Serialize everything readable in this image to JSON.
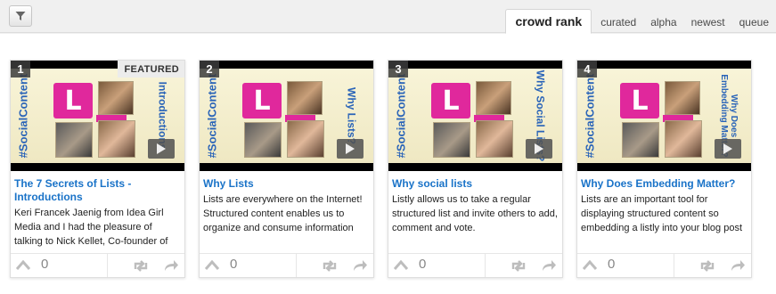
{
  "toolbar": {
    "filter_icon": "filter-icon",
    "tabs": [
      {
        "label": "crowd rank",
        "active": true
      },
      {
        "label": "curated",
        "active": false
      },
      {
        "label": "alpha",
        "active": false
      },
      {
        "label": "newest",
        "active": false
      },
      {
        "label": "queue",
        "active": false
      }
    ]
  },
  "colors": {
    "accent_link": "#1a73c8",
    "brand_pink": "#e0289c",
    "slide_blue": "#2a64b8"
  },
  "cards": [
    {
      "rank": "1",
      "badge": "FEATURED",
      "slide_hashtag": "#SocialContent",
      "slide_side_text": "Introductions",
      "title": "The 7 Secrets of Lists - Introductions",
      "description": "Keri Francek Jaenig from Idea Girl Media and I had the pleasure of talking to Nick Kellet, Co-founder of",
      "votes": "0"
    },
    {
      "rank": "2",
      "badge": "",
      "slide_hashtag": "#SocialContent",
      "slide_side_text": "Why Lists?",
      "title": "Why Lists",
      "description": "Lists are everywhere on the Internet! Structured content enables us to organize and consume information efficiently.",
      "votes": "0"
    },
    {
      "rank": "3",
      "badge": "",
      "slide_hashtag": "#SocialContent",
      "slide_side_text": "Why Social Lists?",
      "title": "Why social lists",
      "description": "Listly allows us to take a regular structured list and invite others to add, comment and vote.",
      "votes": "0"
    },
    {
      "rank": "4",
      "badge": "",
      "slide_hashtag": "#SocialContent",
      "slide_side_text": "Why Does Embedding Matter?",
      "title": "Why Does Embedding Matter?",
      "description": "Lists are an important tool for displaying structured content so embedding a listly into your blog post means bringing the power of",
      "votes": "0"
    }
  ]
}
